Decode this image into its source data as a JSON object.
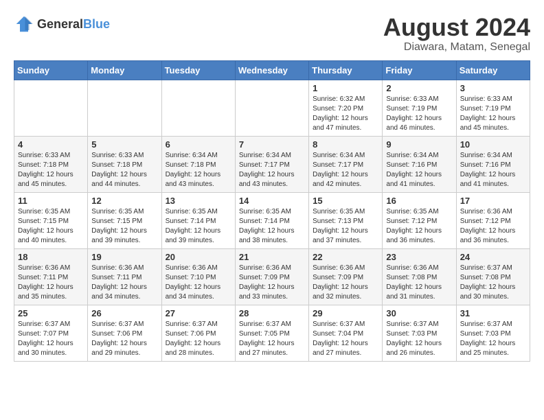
{
  "logo": {
    "general": "General",
    "blue": "Blue"
  },
  "title": {
    "month_year": "August 2024",
    "location": "Diawara, Matam, Senegal"
  },
  "headers": [
    "Sunday",
    "Monday",
    "Tuesday",
    "Wednesday",
    "Thursday",
    "Friday",
    "Saturday"
  ],
  "weeks": [
    [
      {
        "day": "",
        "info": ""
      },
      {
        "day": "",
        "info": ""
      },
      {
        "day": "",
        "info": ""
      },
      {
        "day": "",
        "info": ""
      },
      {
        "day": "1",
        "info": "Sunrise: 6:32 AM\nSunset: 7:20 PM\nDaylight: 12 hours\nand 47 minutes."
      },
      {
        "day": "2",
        "info": "Sunrise: 6:33 AM\nSunset: 7:19 PM\nDaylight: 12 hours\nand 46 minutes."
      },
      {
        "day": "3",
        "info": "Sunrise: 6:33 AM\nSunset: 7:19 PM\nDaylight: 12 hours\nand 45 minutes."
      }
    ],
    [
      {
        "day": "4",
        "info": "Sunrise: 6:33 AM\nSunset: 7:18 PM\nDaylight: 12 hours\nand 45 minutes."
      },
      {
        "day": "5",
        "info": "Sunrise: 6:33 AM\nSunset: 7:18 PM\nDaylight: 12 hours\nand 44 minutes."
      },
      {
        "day": "6",
        "info": "Sunrise: 6:34 AM\nSunset: 7:18 PM\nDaylight: 12 hours\nand 43 minutes."
      },
      {
        "day": "7",
        "info": "Sunrise: 6:34 AM\nSunset: 7:17 PM\nDaylight: 12 hours\nand 43 minutes."
      },
      {
        "day": "8",
        "info": "Sunrise: 6:34 AM\nSunset: 7:17 PM\nDaylight: 12 hours\nand 42 minutes."
      },
      {
        "day": "9",
        "info": "Sunrise: 6:34 AM\nSunset: 7:16 PM\nDaylight: 12 hours\nand 41 minutes."
      },
      {
        "day": "10",
        "info": "Sunrise: 6:34 AM\nSunset: 7:16 PM\nDaylight: 12 hours\nand 41 minutes."
      }
    ],
    [
      {
        "day": "11",
        "info": "Sunrise: 6:35 AM\nSunset: 7:15 PM\nDaylight: 12 hours\nand 40 minutes."
      },
      {
        "day": "12",
        "info": "Sunrise: 6:35 AM\nSunset: 7:15 PM\nDaylight: 12 hours\nand 39 minutes."
      },
      {
        "day": "13",
        "info": "Sunrise: 6:35 AM\nSunset: 7:14 PM\nDaylight: 12 hours\nand 39 minutes."
      },
      {
        "day": "14",
        "info": "Sunrise: 6:35 AM\nSunset: 7:14 PM\nDaylight: 12 hours\nand 38 minutes."
      },
      {
        "day": "15",
        "info": "Sunrise: 6:35 AM\nSunset: 7:13 PM\nDaylight: 12 hours\nand 37 minutes."
      },
      {
        "day": "16",
        "info": "Sunrise: 6:35 AM\nSunset: 7:12 PM\nDaylight: 12 hours\nand 36 minutes."
      },
      {
        "day": "17",
        "info": "Sunrise: 6:36 AM\nSunset: 7:12 PM\nDaylight: 12 hours\nand 36 minutes."
      }
    ],
    [
      {
        "day": "18",
        "info": "Sunrise: 6:36 AM\nSunset: 7:11 PM\nDaylight: 12 hours\nand 35 minutes."
      },
      {
        "day": "19",
        "info": "Sunrise: 6:36 AM\nSunset: 7:11 PM\nDaylight: 12 hours\nand 34 minutes."
      },
      {
        "day": "20",
        "info": "Sunrise: 6:36 AM\nSunset: 7:10 PM\nDaylight: 12 hours\nand 34 minutes."
      },
      {
        "day": "21",
        "info": "Sunrise: 6:36 AM\nSunset: 7:09 PM\nDaylight: 12 hours\nand 33 minutes."
      },
      {
        "day": "22",
        "info": "Sunrise: 6:36 AM\nSunset: 7:09 PM\nDaylight: 12 hours\nand 32 minutes."
      },
      {
        "day": "23",
        "info": "Sunrise: 6:36 AM\nSunset: 7:08 PM\nDaylight: 12 hours\nand 31 minutes."
      },
      {
        "day": "24",
        "info": "Sunrise: 6:37 AM\nSunset: 7:08 PM\nDaylight: 12 hours\nand 30 minutes."
      }
    ],
    [
      {
        "day": "25",
        "info": "Sunrise: 6:37 AM\nSunset: 7:07 PM\nDaylight: 12 hours\nand 30 minutes."
      },
      {
        "day": "26",
        "info": "Sunrise: 6:37 AM\nSunset: 7:06 PM\nDaylight: 12 hours\nand 29 minutes."
      },
      {
        "day": "27",
        "info": "Sunrise: 6:37 AM\nSunset: 7:06 PM\nDaylight: 12 hours\nand 28 minutes."
      },
      {
        "day": "28",
        "info": "Sunrise: 6:37 AM\nSunset: 7:05 PM\nDaylight: 12 hours\nand 27 minutes."
      },
      {
        "day": "29",
        "info": "Sunrise: 6:37 AM\nSunset: 7:04 PM\nDaylight: 12 hours\nand 27 minutes."
      },
      {
        "day": "30",
        "info": "Sunrise: 6:37 AM\nSunset: 7:03 PM\nDaylight: 12 hours\nand 26 minutes."
      },
      {
        "day": "31",
        "info": "Sunrise: 6:37 AM\nSunset: 7:03 PM\nDaylight: 12 hours\nand 25 minutes."
      }
    ]
  ]
}
